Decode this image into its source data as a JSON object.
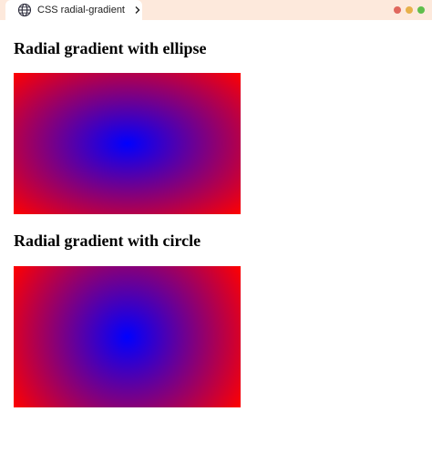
{
  "browser": {
    "tab_title": "CSS radial-gradient",
    "icons": {
      "tab_icon": "globe-icon",
      "tab_arrow": "chevron-right-icon"
    },
    "window_controls": {
      "close_color": "#e0675d",
      "minimize_color": "#e7b04a",
      "maximize_color": "#5fbe4b"
    },
    "bar_color": "#fde9dc"
  },
  "page": {
    "sections": [
      {
        "heading": "Radial gradient with ellipse",
        "gradient_shape": "ellipse",
        "center_color": "blue",
        "edge_color": "red"
      },
      {
        "heading": "Radial gradient with circle",
        "gradient_shape": "circle",
        "center_color": "blue",
        "edge_color": "red"
      }
    ]
  }
}
